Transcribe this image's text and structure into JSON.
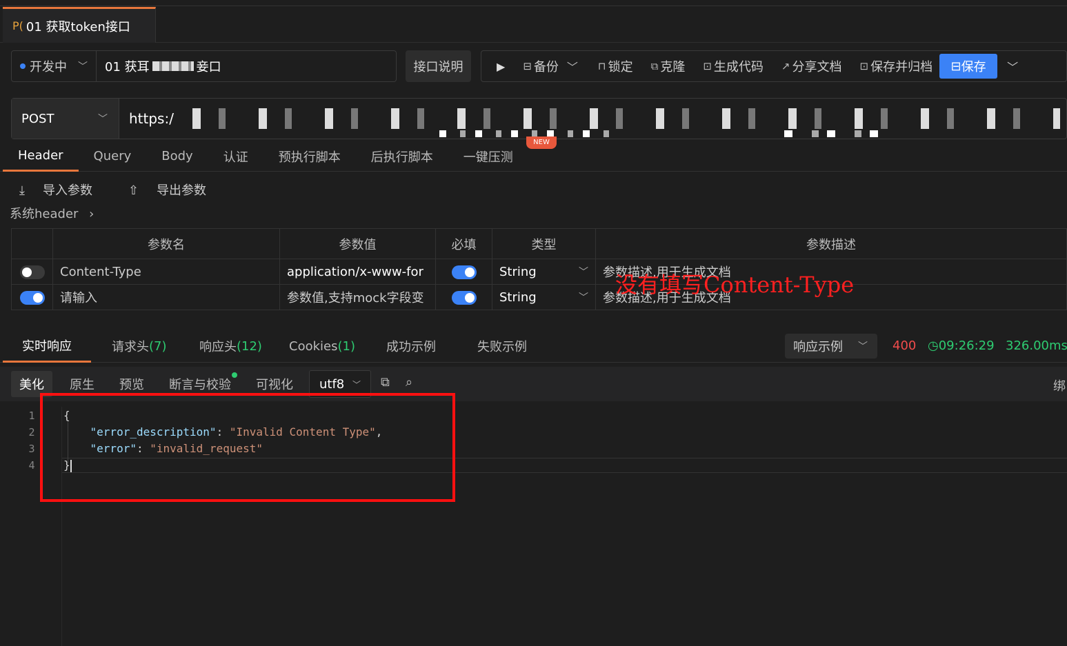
{
  "tab": {
    "method_prefix": "P(",
    "title": "01 获取token接口"
  },
  "api": {
    "status_label": "开发中",
    "name_prefix": "01 获耳",
    "name_suffix": "妾口",
    "doc_button": "接口说明"
  },
  "toolbar": {
    "backup": "备份",
    "lock": "锁定",
    "clone": "克隆",
    "gen_code": "生成代码",
    "share_doc": "分享文档",
    "save_archive": "保存并归档",
    "save": "保存"
  },
  "request": {
    "method": "POST",
    "url_prefix": "https:/",
    "new_badge": "NEW"
  },
  "req_tabs": [
    "Header",
    "Query",
    "Body",
    "认证",
    "预执行脚本",
    "后执行脚本",
    "一键压测"
  ],
  "header_actions": {
    "import": "导入参数",
    "export": "导出参数",
    "system_header": "系统header"
  },
  "params_table": {
    "columns": [
      "参数名",
      "参数值",
      "必填",
      "类型",
      "参数描述"
    ],
    "rows": [
      {
        "enabled": false,
        "name": "Content-Type",
        "value": "application/x-www-for",
        "required": true,
        "type": "String",
        "desc": "参数描述,用于生成文档"
      },
      {
        "enabled": true,
        "name_placeholder": "请输入",
        "value_placeholder": "参数值,支持mock字段变",
        "required": true,
        "type": "String",
        "desc": "参数描述,用于生成文档"
      }
    ]
  },
  "annotation": "没有填写Content-Type",
  "resp_tabs": {
    "realtime": "实时响应",
    "req_header": "请求头",
    "req_header_count": "(7)",
    "resp_header": "响应头",
    "resp_header_count": "(12)",
    "cookies": "Cookies",
    "cookies_count": "(1)",
    "success": "成功示例",
    "fail": "失败示例"
  },
  "resp_meta": {
    "example_label": "响应示例",
    "status": "400",
    "time": "09:26:29",
    "duration": "326.00ms"
  },
  "view_tabs": {
    "pretty": "美化",
    "raw": "原生",
    "preview": "预览",
    "assert": "断言与校验",
    "visual": "可视化",
    "encoding": "utf8",
    "bind": "绑"
  },
  "code": {
    "line_numbers": [
      "1",
      "2",
      "3",
      "4"
    ],
    "open": "{",
    "k1": "\"error_description\"",
    "v1": "\"Invalid Content Type\"",
    "k2": "\"error\"",
    "v2": "\"invalid_request\"",
    "close": "}"
  }
}
